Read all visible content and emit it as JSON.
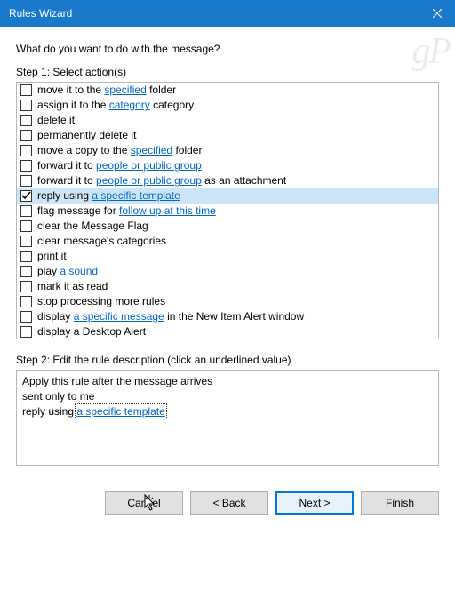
{
  "window": {
    "title": "Rules Wizard",
    "watermark": "gP"
  },
  "prompt": "What do you want to do with the message?",
  "step1_label": "Step 1: Select action(s)",
  "step2_label": "Step 2: Edit the rule description (click an underlined value)",
  "actions": [
    {
      "checked": false,
      "parts": [
        {
          "t": "move it to the "
        },
        {
          "t": "specified",
          "link": true
        },
        {
          "t": " folder"
        }
      ]
    },
    {
      "checked": false,
      "parts": [
        {
          "t": "assign it to the "
        },
        {
          "t": "category",
          "link": true
        },
        {
          "t": " category"
        }
      ]
    },
    {
      "checked": false,
      "parts": [
        {
          "t": "delete it"
        }
      ]
    },
    {
      "checked": false,
      "parts": [
        {
          "t": "permanently delete it"
        }
      ]
    },
    {
      "checked": false,
      "parts": [
        {
          "t": "move a copy to the "
        },
        {
          "t": "specified",
          "link": true
        },
        {
          "t": " folder"
        }
      ]
    },
    {
      "checked": false,
      "parts": [
        {
          "t": "forward it to "
        },
        {
          "t": "people or public group",
          "link": true
        }
      ]
    },
    {
      "checked": false,
      "parts": [
        {
          "t": "forward it to "
        },
        {
          "t": "people or public group",
          "link": true
        },
        {
          "t": " as an attachment"
        }
      ]
    },
    {
      "checked": true,
      "selected": true,
      "parts": [
        {
          "t": "reply using "
        },
        {
          "t": "a specific template",
          "link": true
        }
      ]
    },
    {
      "checked": false,
      "parts": [
        {
          "t": "flag message for "
        },
        {
          "t": "follow up at this time",
          "link": true
        }
      ]
    },
    {
      "checked": false,
      "parts": [
        {
          "t": "clear the Message Flag"
        }
      ]
    },
    {
      "checked": false,
      "parts": [
        {
          "t": "clear message's categories"
        }
      ]
    },
    {
      "checked": false,
      "parts": [
        {
          "t": "print it"
        }
      ]
    },
    {
      "checked": false,
      "parts": [
        {
          "t": "play "
        },
        {
          "t": "a sound",
          "link": true
        }
      ]
    },
    {
      "checked": false,
      "parts": [
        {
          "t": "mark it as read"
        }
      ]
    },
    {
      "checked": false,
      "parts": [
        {
          "t": "stop processing more rules"
        }
      ]
    },
    {
      "checked": false,
      "parts": [
        {
          "t": "display "
        },
        {
          "t": "a specific message",
          "link": true
        },
        {
          "t": " in the New Item Alert window"
        }
      ]
    },
    {
      "checked": false,
      "parts": [
        {
          "t": "display a Desktop Alert"
        }
      ]
    }
  ],
  "description": [
    [
      {
        "t": "Apply this rule after the message arrives"
      }
    ],
    [
      {
        "t": "sent only to me"
      }
    ],
    [
      {
        "t": "reply using "
      },
      {
        "t": "a specific template",
        "link": true,
        "focused": true
      }
    ]
  ],
  "buttons": {
    "cancel": "Cancel",
    "back": "< Back",
    "next": "Next >",
    "finish": "Finish"
  }
}
